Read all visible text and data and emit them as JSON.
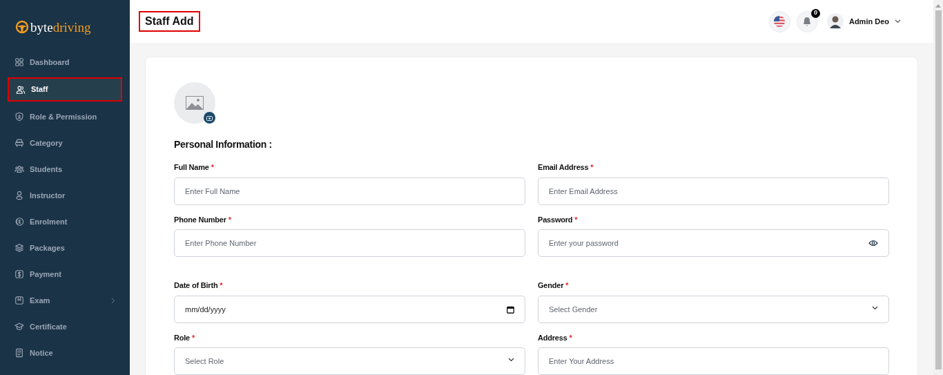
{
  "brand": {
    "first": "byte",
    "second": "driving"
  },
  "sidebar": {
    "items": [
      {
        "label": "Dashboard",
        "selected": false,
        "expandable": false
      },
      {
        "label": "Staff",
        "selected": true,
        "expandable": false
      },
      {
        "label": "Role & Permission",
        "selected": false,
        "expandable": false
      },
      {
        "label": "Category",
        "selected": false,
        "expandable": false
      },
      {
        "label": "Students",
        "selected": false,
        "expandable": false
      },
      {
        "label": "Instructor",
        "selected": false,
        "expandable": false
      },
      {
        "label": "Enrolment",
        "selected": false,
        "expandable": false
      },
      {
        "label": "Packages",
        "selected": false,
        "expandable": false
      },
      {
        "label": "Payment",
        "selected": false,
        "expandable": false
      },
      {
        "label": "Exam",
        "selected": false,
        "expandable": true
      },
      {
        "label": "Certificate",
        "selected": false,
        "expandable": false
      },
      {
        "label": "Notice",
        "selected": false,
        "expandable": false
      }
    ]
  },
  "header": {
    "title": "Staff Add",
    "notification_count": "0",
    "user_name": "Admin Deo"
  },
  "form": {
    "section_title": "Personal Information :",
    "fields": [
      {
        "label": "Full Name",
        "required_mark": "*",
        "kind": "text",
        "placeholder": "Enter Full Name"
      },
      {
        "label": "Email Address",
        "required_mark": "*",
        "kind": "text",
        "placeholder": "Enter Email Address"
      },
      {
        "label": "Phone Number",
        "required_mark": "*",
        "kind": "text",
        "placeholder": "Enter Phone Number"
      },
      {
        "label": "Password",
        "required_mark": "*",
        "kind": "password",
        "placeholder": "Enter your password"
      },
      {
        "label": "Date of Birth",
        "required_mark": "*",
        "kind": "date",
        "placeholder": "mm/dd/yyyy"
      },
      {
        "label": "Gender",
        "required_mark": "*",
        "kind": "select",
        "placeholder": "Select Gender"
      },
      {
        "label": "Role",
        "required_mark": "*",
        "kind": "select",
        "placeholder": "Select Role"
      },
      {
        "label": "Address",
        "required_mark": "*",
        "kind": "text",
        "placeholder": "Enter Your Address"
      }
    ]
  }
}
